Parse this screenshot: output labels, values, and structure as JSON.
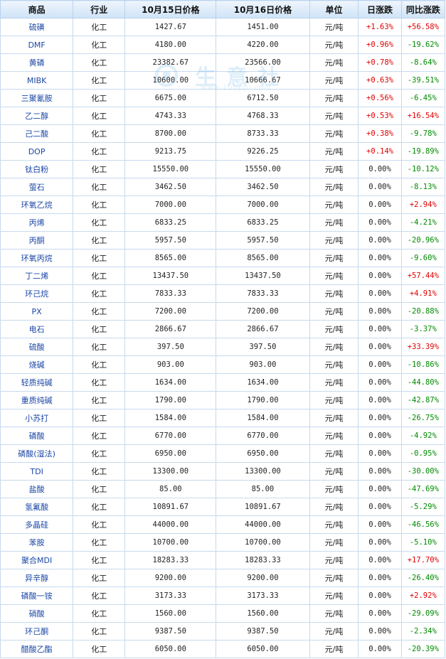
{
  "headers": [
    "商品",
    "行业",
    "10月15日价格",
    "10月16日价格",
    "单位",
    "日涨跌",
    "同比涨跌"
  ],
  "watermark": {
    "text": "生意社",
    "url": "www.100ppi.com"
  },
  "rows": [
    {
      "name": "硫磺",
      "industry": "化工",
      "p1": "1427.67",
      "p2": "1451.00",
      "unit": "元/吨",
      "day": "+1.63%",
      "yoy": "+56.58%"
    },
    {
      "name": "DMF",
      "industry": "化工",
      "p1": "4180.00",
      "p2": "4220.00",
      "unit": "元/吨",
      "day": "+0.96%",
      "yoy": "-19.62%"
    },
    {
      "name": "黄磷",
      "industry": "化工",
      "p1": "23382.67",
      "p2": "23566.00",
      "unit": "元/吨",
      "day": "+0.78%",
      "yoy": "-8.64%"
    },
    {
      "name": "MIBK",
      "industry": "化工",
      "p1": "10600.00",
      "p2": "10666.67",
      "unit": "元/吨",
      "day": "+0.63%",
      "yoy": "-39.51%"
    },
    {
      "name": "三聚氰胺",
      "industry": "化工",
      "p1": "6675.00",
      "p2": "6712.50",
      "unit": "元/吨",
      "day": "+0.56%",
      "yoy": "-6.45%"
    },
    {
      "name": "乙二醇",
      "industry": "化工",
      "p1": "4743.33",
      "p2": "4768.33",
      "unit": "元/吨",
      "day": "+0.53%",
      "yoy": "+16.54%"
    },
    {
      "name": "己二酸",
      "industry": "化工",
      "p1": "8700.00",
      "p2": "8733.33",
      "unit": "元/吨",
      "day": "+0.38%",
      "yoy": "-9.78%"
    },
    {
      "name": "DOP",
      "industry": "化工",
      "p1": "9213.75",
      "p2": "9226.25",
      "unit": "元/吨",
      "day": "+0.14%",
      "yoy": "-19.89%"
    },
    {
      "name": "钛白粉",
      "industry": "化工",
      "p1": "15550.00",
      "p2": "15550.00",
      "unit": "元/吨",
      "day": "0.00%",
      "yoy": "-10.12%"
    },
    {
      "name": "萤石",
      "industry": "化工",
      "p1": "3462.50",
      "p2": "3462.50",
      "unit": "元/吨",
      "day": "0.00%",
      "yoy": "-8.13%"
    },
    {
      "name": "环氧乙烷",
      "industry": "化工",
      "p1": "7000.00",
      "p2": "7000.00",
      "unit": "元/吨",
      "day": "0.00%",
      "yoy": "+2.94%"
    },
    {
      "name": "丙烯",
      "industry": "化工",
      "p1": "6833.25",
      "p2": "6833.25",
      "unit": "元/吨",
      "day": "0.00%",
      "yoy": "-4.21%"
    },
    {
      "name": "丙酮",
      "industry": "化工",
      "p1": "5957.50",
      "p2": "5957.50",
      "unit": "元/吨",
      "day": "0.00%",
      "yoy": "-20.96%"
    },
    {
      "name": "环氧丙烷",
      "industry": "化工",
      "p1": "8565.00",
      "p2": "8565.00",
      "unit": "元/吨",
      "day": "0.00%",
      "yoy": "-9.60%"
    },
    {
      "name": "丁二烯",
      "industry": "化工",
      "p1": "13437.50",
      "p2": "13437.50",
      "unit": "元/吨",
      "day": "0.00%",
      "yoy": "+57.44%"
    },
    {
      "name": "环己烷",
      "industry": "化工",
      "p1": "7833.33",
      "p2": "7833.33",
      "unit": "元/吨",
      "day": "0.00%",
      "yoy": "+4.91%"
    },
    {
      "name": "PX",
      "industry": "化工",
      "p1": "7200.00",
      "p2": "7200.00",
      "unit": "元/吨",
      "day": "0.00%",
      "yoy": "-20.88%"
    },
    {
      "name": "电石",
      "industry": "化工",
      "p1": "2866.67",
      "p2": "2866.67",
      "unit": "元/吨",
      "day": "0.00%",
      "yoy": "-3.37%"
    },
    {
      "name": "硫酸",
      "industry": "化工",
      "p1": "397.50",
      "p2": "397.50",
      "unit": "元/吨",
      "day": "0.00%",
      "yoy": "+33.39%"
    },
    {
      "name": "烧碱",
      "industry": "化工",
      "p1": "903.00",
      "p2": "903.00",
      "unit": "元/吨",
      "day": "0.00%",
      "yoy": "-10.86%"
    },
    {
      "name": "轻质纯碱",
      "industry": "化工",
      "p1": "1634.00",
      "p2": "1634.00",
      "unit": "元/吨",
      "day": "0.00%",
      "yoy": "-44.80%"
    },
    {
      "name": "重质纯碱",
      "industry": "化工",
      "p1": "1790.00",
      "p2": "1790.00",
      "unit": "元/吨",
      "day": "0.00%",
      "yoy": "-42.87%"
    },
    {
      "name": "小苏打",
      "industry": "化工",
      "p1": "1584.00",
      "p2": "1584.00",
      "unit": "元/吨",
      "day": "0.00%",
      "yoy": "-26.75%"
    },
    {
      "name": "磷酸",
      "industry": "化工",
      "p1": "6770.00",
      "p2": "6770.00",
      "unit": "元/吨",
      "day": "0.00%",
      "yoy": "-4.92%"
    },
    {
      "name": "磷酸(湿法)",
      "industry": "化工",
      "p1": "6950.00",
      "p2": "6950.00",
      "unit": "元/吨",
      "day": "0.00%",
      "yoy": "-0.95%"
    },
    {
      "name": "TDI",
      "industry": "化工",
      "p1": "13300.00",
      "p2": "13300.00",
      "unit": "元/吨",
      "day": "0.00%",
      "yoy": "-30.00%"
    },
    {
      "name": "盐酸",
      "industry": "化工",
      "p1": "85.00",
      "p2": "85.00",
      "unit": "元/吨",
      "day": "0.00%",
      "yoy": "-47.69%"
    },
    {
      "name": "氢氟酸",
      "industry": "化工",
      "p1": "10891.67",
      "p2": "10891.67",
      "unit": "元/吨",
      "day": "0.00%",
      "yoy": "-5.29%"
    },
    {
      "name": "多晶硅",
      "industry": "化工",
      "p1": "44000.00",
      "p2": "44000.00",
      "unit": "元/吨",
      "day": "0.00%",
      "yoy": "-46.56%"
    },
    {
      "name": "苯胺",
      "industry": "化工",
      "p1": "10700.00",
      "p2": "10700.00",
      "unit": "元/吨",
      "day": "0.00%",
      "yoy": "-5.10%"
    },
    {
      "name": "聚合MDI",
      "industry": "化工",
      "p1": "18283.33",
      "p2": "18283.33",
      "unit": "元/吨",
      "day": "0.00%",
      "yoy": "+17.70%"
    },
    {
      "name": "异辛醇",
      "industry": "化工",
      "p1": "9200.00",
      "p2": "9200.00",
      "unit": "元/吨",
      "day": "0.00%",
      "yoy": "-26.40%"
    },
    {
      "name": "磷酸一铵",
      "industry": "化工",
      "p1": "3173.33",
      "p2": "3173.33",
      "unit": "元/吨",
      "day": "0.00%",
      "yoy": "+2.92%"
    },
    {
      "name": "硝酸",
      "industry": "化工",
      "p1": "1560.00",
      "p2": "1560.00",
      "unit": "元/吨",
      "day": "0.00%",
      "yoy": "-29.09%"
    },
    {
      "name": "环己酮",
      "industry": "化工",
      "p1": "9387.50",
      "p2": "9387.50",
      "unit": "元/吨",
      "day": "0.00%",
      "yoy": "-2.34%"
    },
    {
      "name": "醋酸乙酯",
      "industry": "化工",
      "p1": "6050.00",
      "p2": "6050.00",
      "unit": "元/吨",
      "day": "0.00%",
      "yoy": "-20.39%"
    }
  ],
  "colors": {
    "up": "#e00000",
    "down": "#008a00",
    "link": "#1b47a6",
    "header_bg": "#cfe3f7",
    "border": "#c7daee"
  }
}
